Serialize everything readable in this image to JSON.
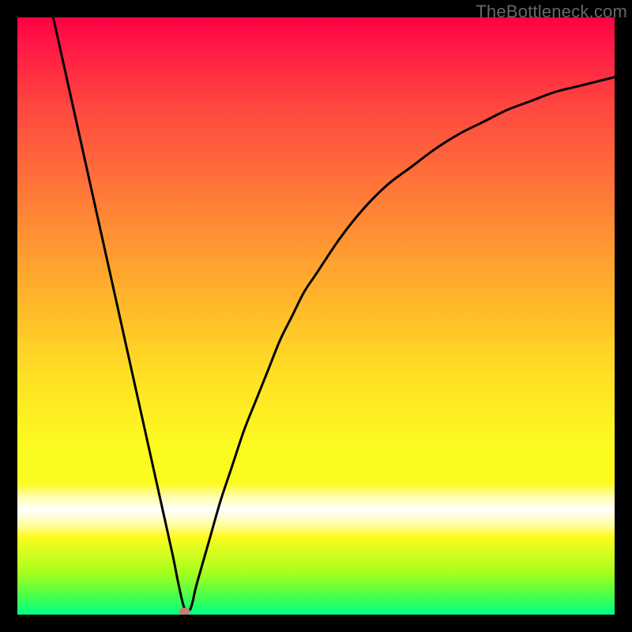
{
  "watermark": "TheBottleneck.com",
  "chart_data": {
    "type": "line",
    "title": "",
    "xlabel": "",
    "ylabel": "",
    "xlim": [
      0,
      100
    ],
    "ylim": [
      0,
      100
    ],
    "x": [
      6,
      8,
      10,
      12,
      14,
      16,
      18,
      20,
      22,
      24,
      26,
      27,
      28,
      29,
      30,
      32,
      34,
      36,
      38,
      40,
      42,
      44,
      46,
      48,
      50,
      54,
      58,
      62,
      66,
      70,
      74,
      78,
      82,
      86,
      90,
      94,
      98,
      100
    ],
    "values": [
      100,
      91,
      82,
      73,
      64,
      55,
      46,
      37,
      28,
      19,
      10,
      5,
      1,
      1,
      5,
      12,
      19,
      25,
      31,
      36,
      41,
      46,
      50,
      54,
      57,
      63,
      68,
      72,
      75,
      78,
      80.5,
      82.5,
      84.5,
      86,
      87.5,
      88.5,
      89.5,
      90
    ],
    "marker": {
      "x": 28,
      "y": 0.5
    },
    "gradient_stops": [
      {
        "offset": 0.0,
        "color": "#ff0044"
      },
      {
        "offset": 0.05,
        "color": "#ff1a44"
      },
      {
        "offset": 0.15,
        "color": "#ff4740"
      },
      {
        "offset": 0.3,
        "color": "#ff7b38"
      },
      {
        "offset": 0.45,
        "color": "#ffae2c"
      },
      {
        "offset": 0.6,
        "color": "#ffe024"
      },
      {
        "offset": 0.72,
        "color": "#fcfb1f"
      },
      {
        "offset": 0.78,
        "color": "#fcfb1f"
      },
      {
        "offset": 0.8,
        "color": "#fffda0"
      },
      {
        "offset": 0.825,
        "color": "#ffffff"
      },
      {
        "offset": 0.85,
        "color": "#fffda0"
      },
      {
        "offset": 0.87,
        "color": "#fcfb1f"
      },
      {
        "offset": 0.93,
        "color": "#a6ff1d"
      },
      {
        "offset": 0.97,
        "color": "#46ff4d"
      },
      {
        "offset": 1.0,
        "color": "#00ff88"
      }
    ]
  }
}
